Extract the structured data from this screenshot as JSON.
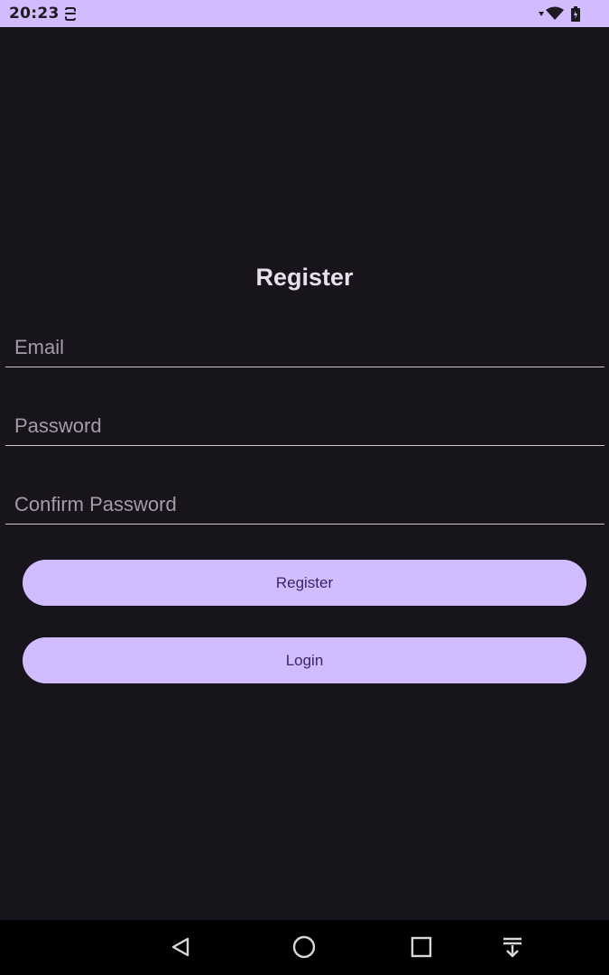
{
  "status_bar": {
    "time": "20:23",
    "notification_icon": "sync-icon",
    "wifi_icon": "wifi-icon",
    "battery_icon": "battery-icon",
    "bg_color": "#d2bcfd"
  },
  "form": {
    "title": "Register",
    "email": {
      "value": "",
      "placeholder": "Email"
    },
    "password": {
      "value": "",
      "placeholder": "Password"
    },
    "confirm_password": {
      "value": "",
      "placeholder": "Confirm Password"
    },
    "register_label": "Register",
    "login_label": "Login"
  },
  "colors": {
    "background": "#17141c",
    "button_bg": "#d0bcfe",
    "button_text": "#3a2566",
    "title_text": "#e6e0ea",
    "placeholder_text": "#a49da8"
  },
  "nav_bar": {
    "back_icon": "back-triangle-icon",
    "home_icon": "home-circle-icon",
    "recents_icon": "recents-square-icon",
    "extra_icon": "notification-pull-down-icon"
  }
}
